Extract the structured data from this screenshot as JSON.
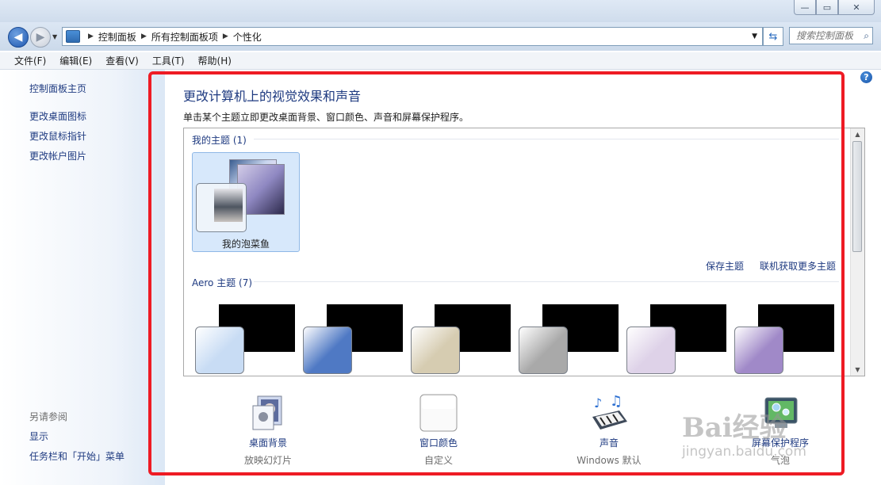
{
  "window": {
    "controls": {
      "minimize": "—",
      "restore": "▭",
      "close": "✕"
    }
  },
  "address": {
    "crumbs": [
      "控制面板",
      "所有控制面板项",
      "个性化"
    ],
    "search_placeholder": "搜索控制面板"
  },
  "menu": [
    "文件(F)",
    "编辑(E)",
    "查看(V)",
    "工具(T)",
    "帮助(H)"
  ],
  "sidebar": {
    "home": "控制面板主页",
    "links": [
      "更改桌面图标",
      "更改鼠标指针",
      "更改帐户图片"
    ],
    "see_also_title": "另请参阅",
    "see_also": [
      "显示",
      "任务栏和「开始」菜单"
    ]
  },
  "main": {
    "title": "更改计算机上的视觉效果和声音",
    "description": "单击某个主题立即更改桌面背景、窗口颜色、声音和屏幕保护程序。",
    "my_themes_header": "我的主题 (1)",
    "my_theme_name": "我的泡菜鱼",
    "save_theme": "保存主题",
    "more_themes": "联机获取更多主题",
    "aero_header": "Aero 主题 (7)",
    "aero_glass_colors": [
      "#c8dcf4",
      "#4f79c4",
      "#d6ccb1",
      "#a9a9a9",
      "#ded2e8",
      "#a089c8"
    ]
  },
  "options": [
    {
      "label": "桌面背景",
      "value": "放映幻灯片",
      "icon": "desktop-background-icon"
    },
    {
      "label": "窗口颜色",
      "value": "自定义",
      "icon": "window-color-icon"
    },
    {
      "label": "声音",
      "value": "Windows 默认",
      "icon": "sound-icon"
    },
    {
      "label": "屏幕保护程序",
      "value": "气泡",
      "icon": "screensaver-icon"
    }
  ],
  "watermark": {
    "brand": "Bai经验",
    "url": "jingyan.baidu.com"
  },
  "colors": {
    "link": "#1e3a80",
    "highlight": "#ee1b24"
  }
}
